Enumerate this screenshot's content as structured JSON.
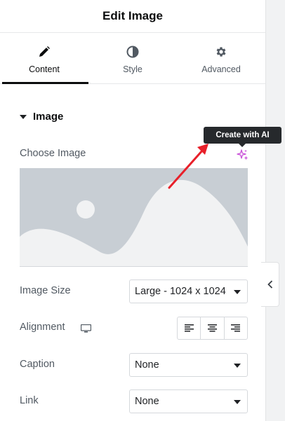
{
  "header": {
    "title": "Edit Image"
  },
  "tabs": [
    {
      "label": "Content",
      "icon": "pencil-icon",
      "active": true
    },
    {
      "label": "Style",
      "icon": "contrast-icon",
      "active": false
    },
    {
      "label": "Advanced",
      "icon": "gear-icon",
      "active": false
    }
  ],
  "section": {
    "title": "Image"
  },
  "choose_image": {
    "label": "Choose Image",
    "ai_icon": "sparkle-icon",
    "tooltip": "Create with AI"
  },
  "image_size": {
    "label": "Image Size",
    "value": "Large - 1024 x 1024"
  },
  "alignment": {
    "label": "Alignment",
    "device_icon": "monitor-icon",
    "options": [
      "align-left-icon",
      "align-center-icon",
      "align-right-icon"
    ]
  },
  "caption": {
    "label": "Caption",
    "value": "None"
  },
  "link": {
    "label": "Link",
    "value": "None"
  },
  "colors": {
    "accent_arrow": "#e8202a",
    "ai_sparkle": "#c94fd8",
    "placeholder_bg": "#c8ced4",
    "placeholder_fg": "#f1f2f3"
  },
  "panel_toggle": {
    "icon": "chevron-left-icon"
  }
}
